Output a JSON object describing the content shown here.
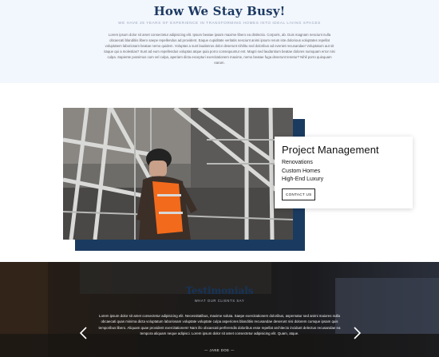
{
  "intro": {
    "title": "How We Stay Busy!",
    "subtitle": "We have 25 years of experience in transforming homes into ideal living spaces",
    "paragraph": "Lorem ipsum dolor sit amet consectetur adipisicing elit. Ipsum beatae ipsam maxime libero ea distinctio. Corporis, ab. Duis magnam nesciunt nulla obcaecati blanditiis libero saepe repellendus ad provident. Eaque cupiditate veritatis nesciunt animi ipsum rerum iste dolorious voluptates repellat voluptatem laboriosam beatae nemo quidem. Voluptas a sunt laudanrus dolor deserunt nihilitu sed doloribus ad eveniet recusandae! Voluptatum aut sit itaque qui a molestias? Sunt ad eum repellendus voluptas atque quia porro consequuntur ent. Magni sed laudantium beatae dolores numquam error nisi culpa. Sapiente possimus cum vel culpa, aperiam dicta excepturi exercitationem maxime, nemo beatae fuga deserunt tenetur? Nihil porro quisquam earum."
  },
  "project": {
    "title": "Project Management",
    "items": [
      "Renovations",
      "Custom Homes",
      "High-End Luxury"
    ],
    "button_label": "Contact Us"
  },
  "testimonials": {
    "title": "Testimonials",
    "subtitle": "What our clients say",
    "quote": "Lorem ipsum dolor sit amet consectetur adipisicing elit. Necessitatibus, maxime soluta. Saepe exercitationem doloribus, aspernatur sed animi maiores nulla obcaecati quas minima dicta voluptatum laboriosam voluptate voluptate culpa asperiores blanditiis recusandae deserunt nisi dolorem cumque ipsam quis temporibus libero. Aliquam quae provident exercitationem! Nam illo obcaecati perferendis doloribus esse repellat architecto incidunt delectus recusandae ea tempora aliquam neque adipisci. Lorem ipsum dolor sit amet consectetur adipisicing elit. Quam, atque.",
    "author": "— Jane Doe —"
  },
  "icons": {
    "prev": "chevron-left-icon",
    "next": "chevron-right-icon"
  },
  "colors": {
    "navy": "#1b3a60",
    "heading": "#1d3a63",
    "intro_bg": "#f2f6fd",
    "safety_orange": "#f26a1b"
  }
}
